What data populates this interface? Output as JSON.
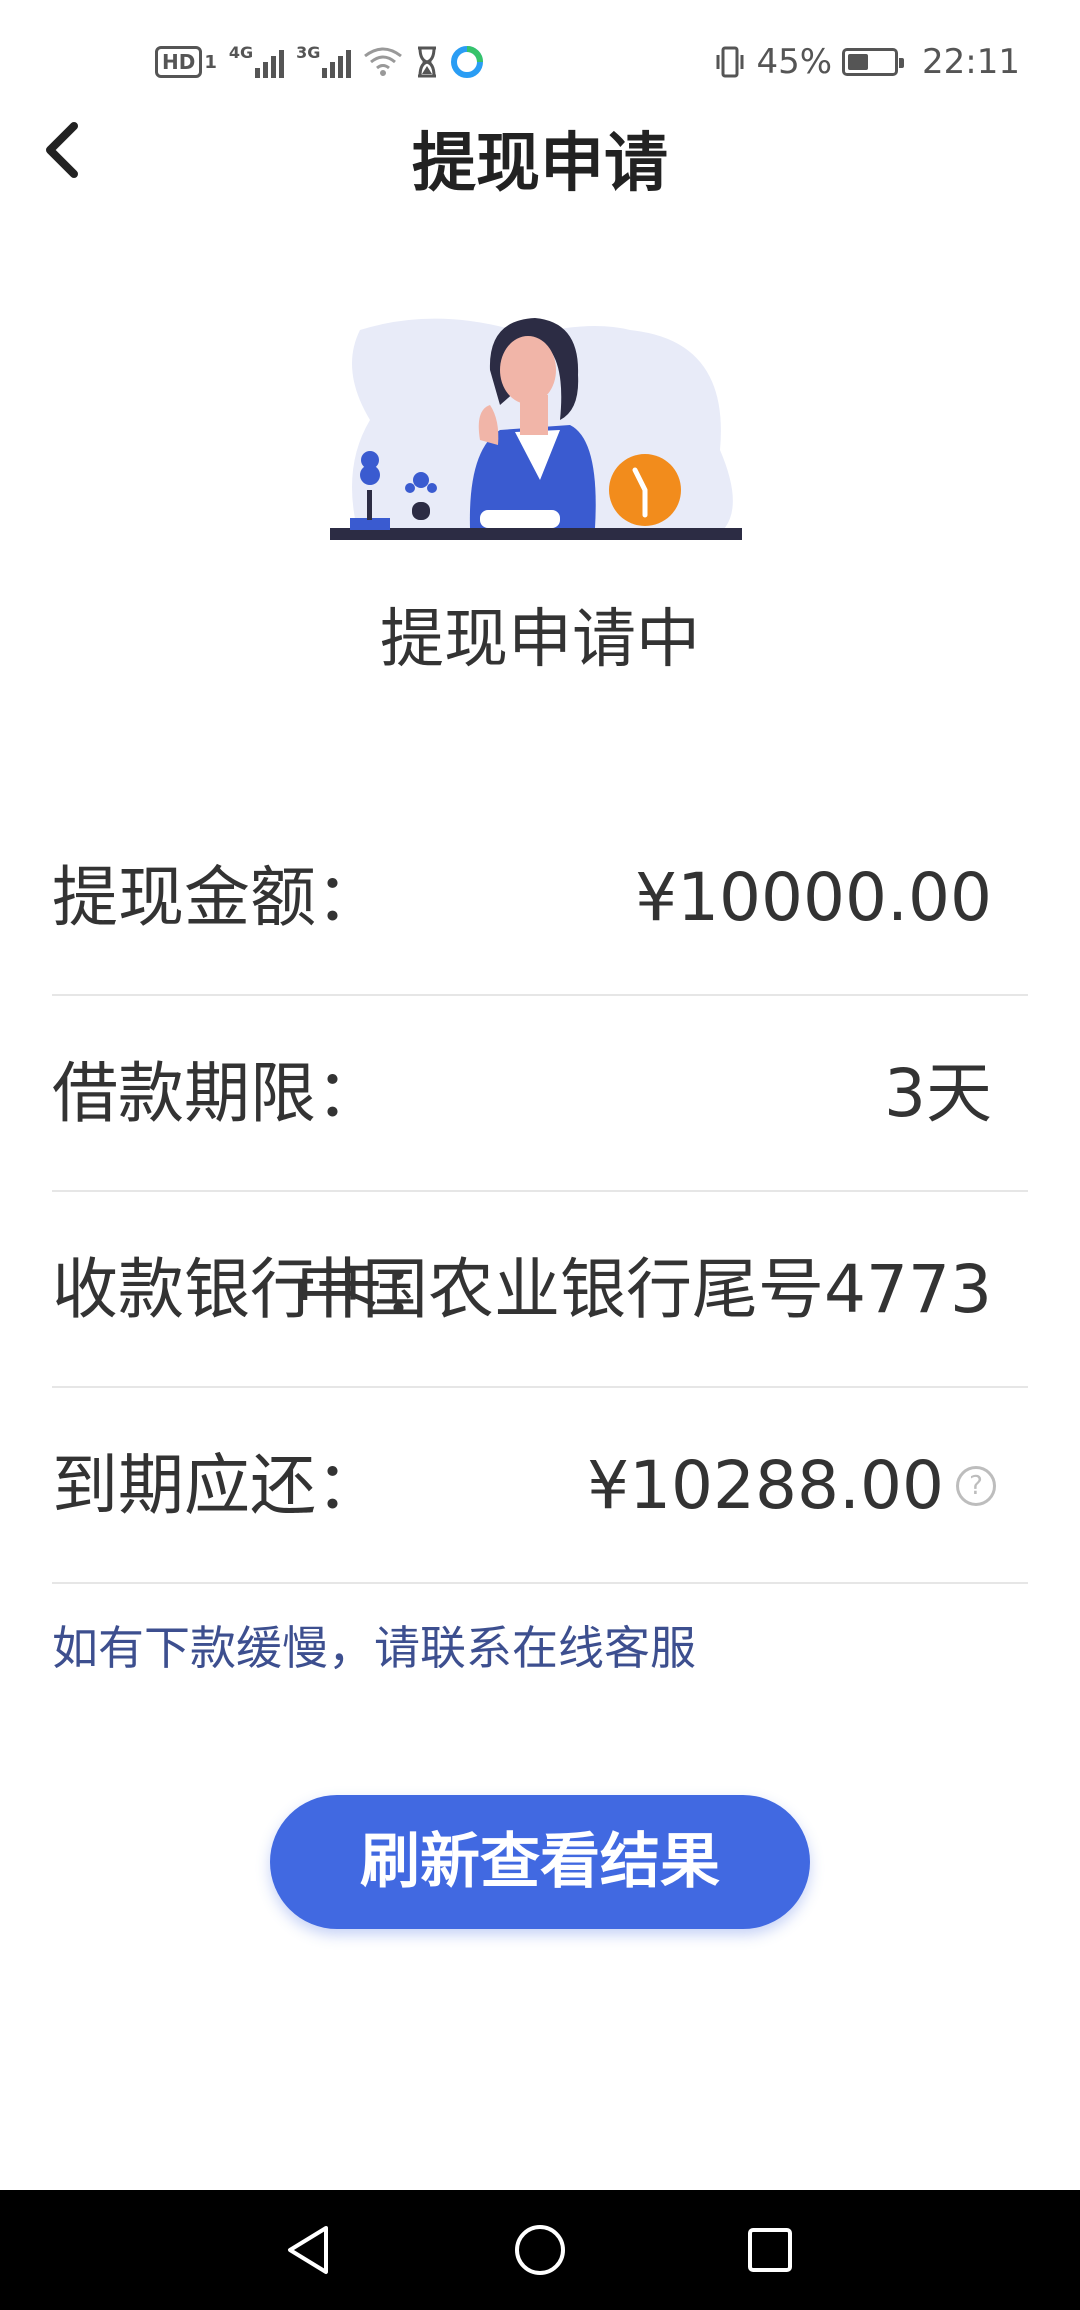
{
  "status_bar": {
    "hd": "HD",
    "sim1": "1",
    "net1": "4G",
    "net2": "3G",
    "battery_percent": "45%",
    "battery_level": 0.45,
    "time": "22:11"
  },
  "header": {
    "title": "提现申请"
  },
  "status": {
    "text": "提现申请中"
  },
  "info": {
    "rows": [
      {
        "label": "提现金额：",
        "value": "¥10000.00"
      },
      {
        "label": "借款期限：",
        "value": "3天"
      },
      {
        "label": "收款银行卡：",
        "value": "中国农业银行尾号4773"
      },
      {
        "label": "到期应还：",
        "value": "¥10288.00",
        "help": "?"
      }
    ]
  },
  "tip": "如有下款缓慢，请联系在线客服",
  "refresh_button": "刷新查看结果",
  "colors": {
    "accent": "#4169e1",
    "tip": "#3d4f8f",
    "illustration_blob": "#e8ebf8",
    "clock": "#f28c1c"
  }
}
